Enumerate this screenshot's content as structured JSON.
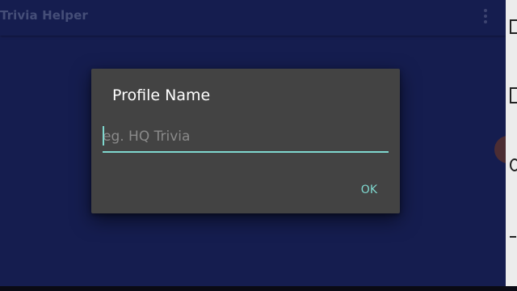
{
  "app_bar": {
    "title": "Trivia Helper",
    "overflow_icon": "more-vert-icon"
  },
  "dialog": {
    "title": "Profile Name",
    "input": {
      "value": "",
      "placeholder": "eg. HQ Trivia"
    },
    "ok_label": "OK"
  },
  "colors": {
    "background": "#151d4f",
    "dialog": "#434343",
    "accent": "#7fd8cf"
  }
}
